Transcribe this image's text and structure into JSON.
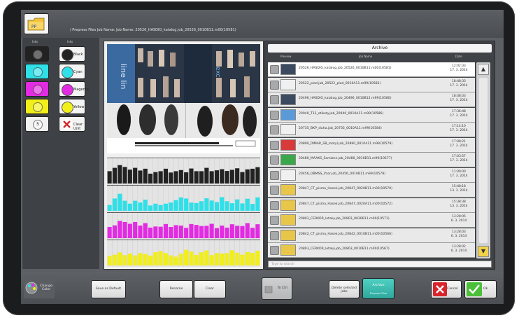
{
  "topbar": {
    "path_text": "/ Prepress Files   Job Name:   Job Name: 20526_HASDIG_katalog.job_20526_0010B11.m00(10581)"
  },
  "left_panel": {
    "inks_header": "Inks",
    "inks_header2": "Inks",
    "inks": [
      {
        "name": "black",
        "label": "Black",
        "color": "#222222",
        "knob": ""
      },
      {
        "name": "cyan",
        "label": "Cyan",
        "color": "#2fe0e8",
        "knob": ""
      },
      {
        "name": "magenta",
        "label": "Magenta",
        "color": "#e22be2",
        "knob": ""
      },
      {
        "name": "yellow",
        "label": "Yellow",
        "color": "#f2ee1a",
        "knob": ""
      },
      {
        "name": "unit5",
        "label": "Clear Unit",
        "color": "#f2f2f2",
        "knob": "5"
      }
    ]
  },
  "archive": {
    "title": "Archive",
    "col_preview": "Preview",
    "col_name": "Job Name",
    "col_date": "Date",
    "search_placeholder": "Type to search",
    "jobs": [
      {
        "name": "20526_HASDIG_katalog.job_20526_0010B11.m00(10581)",
        "time": "12:02:33",
        "date": "17. 3. 2014",
        "thumb": "photo"
      },
      {
        "name": "20522_plad.job_20522_plad_0010A11.m99(10582)",
        "time": "18:48:33",
        "date": "17. 3. 2014",
        "thumb": "white"
      },
      {
        "name": "20496_HASDIG_katalog.job_20496_0010B12.m99(10580)",
        "time": "18:48:03",
        "date": "17. 3. 2014",
        "thumb": "photo"
      },
      {
        "name": "20940_T12_etikety.job_20940_0010A11.m99(10586)",
        "time": "17:36:48",
        "date": "17. 3. 2014",
        "thumb": "blue"
      },
      {
        "name": "20735_BKP_sluha.job_20735_0010A11.m99(10584)",
        "time": "17:14:10",
        "date": "17. 3. 2014",
        "thumb": "white"
      },
      {
        "name": "20890_DIMAR_SB_motyl.job_20890_0010A11.m99(10579)",
        "time": "17:08:21",
        "date": "17. 3. 2014",
        "thumb": "red"
      },
      {
        "name": "20480_MAAKS_Samizne.job_20480_0010B11.m99(10577)",
        "time": "17:03:57",
        "date": "17. 3. 2014",
        "thumb": "green"
      },
      {
        "name": "20456_OBMSS_Vzor.job_20456_0010B11.m99(10578)",
        "time": "11:00:00",
        "date": "17. 3. 2014",
        "thumb": "white"
      },
      {
        "name": "20847_CT_pisma_Hasek.job_20847_0020B11.m00(10570)",
        "time": "15:48:18",
        "date": "13. 3. 2014",
        "thumb": "yellow"
      },
      {
        "name": "20847_CT_pisma_Hasek.job_20847_0020A11.m00(10572)",
        "time": "15:38:38",
        "date": "13. 3. 2014",
        "thumb": "yellow"
      },
      {
        "name": "20803_CERKOR_letaky.job_20803_0030B11.m00(10571)",
        "time": "13:28:05",
        "date": "6. 3. 2014",
        "thumb": "yellow"
      },
      {
        "name": "20842_CT_pisma_Hasek.job_20842_0010B11.m00(10566)",
        "time": "13:28:03",
        "date": "6. 3. 2014",
        "thumb": "yellow"
      },
      {
        "name": "20803_CERKOR_letaky.job_20803_0010B11.m00(10567)",
        "time": "13:28:02",
        "date": "6. 3. 2014",
        "thumb": "yellow"
      }
    ]
  },
  "bottom": {
    "change_color": "Change Color",
    "save_default": "Save as Default",
    "rename": "Rename",
    "clear": "Clear",
    "to_ctrl": "To Ctrl",
    "delete_selected": "Delete selected jobs",
    "archive_btn": "Archive",
    "archive_sub": "Prepress Files",
    "cancel": "Cancel",
    "ok": "Ok"
  },
  "colors": {
    "cyan": "#2fe0e8",
    "magenta": "#e22be2",
    "yellow": "#f2ee1a",
    "black": "#222222"
  },
  "ink_profile": {
    "black": [
      0.55,
      0.7,
      0.82,
      0.74,
      0.62,
      0.7,
      0.58,
      0.66,
      0.44,
      0.51,
      0.55,
      0.66,
      0.49,
      0.55,
      0.6,
      0.5,
      0.67,
      0.55,
      0.55,
      0.7,
      0.55,
      0.59,
      0.64,
      0.56,
      0.61,
      0.68,
      0.51,
      0.63,
      0.66,
      0.73
    ],
    "cyan": [
      0.26,
      0.55,
      0.76,
      0.45,
      0.32,
      0.45,
      0.37,
      0.5,
      0.24,
      0.32,
      0.26,
      0.32,
      0.37,
      0.48,
      0.6,
      0.55,
      0.37,
      0.35,
      0.43,
      0.56,
      0.46,
      0.39,
      0.61,
      0.43,
      0.34,
      0.51,
      0.33,
      0.54,
      0.31,
      0.6
    ],
    "magenta": [
      0.5,
      0.57,
      0.77,
      0.72,
      0.64,
      0.72,
      0.56,
      0.67,
      0.47,
      0.52,
      0.51,
      0.63,
      0.5,
      0.58,
      0.56,
      0.46,
      0.63,
      0.59,
      0.54,
      0.55,
      0.64,
      0.45,
      0.56,
      0.47,
      0.62,
      0.55,
      0.54,
      0.67,
      0.46,
      0.62
    ],
    "yellow": [
      0.42,
      0.48,
      0.58,
      0.46,
      0.53,
      0.45,
      0.55,
      0.51,
      0.44,
      0.59,
      0.64,
      0.55,
      0.45,
      0.39,
      0.53,
      0.7,
      0.62,
      0.47,
      0.59,
      0.67,
      0.46,
      0.55,
      0.53,
      0.55,
      0.68,
      0.57,
      0.48,
      0.6,
      0.56,
      0.66
    ]
  }
}
